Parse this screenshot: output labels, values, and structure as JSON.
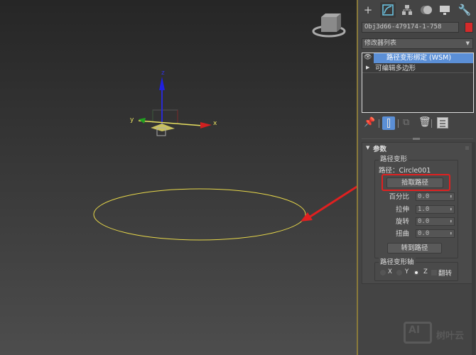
{
  "viewport": {
    "axis_x": "x",
    "axis_y": "y",
    "axis_z": "z",
    "shape_color": "#e8d84a"
  },
  "panel": {
    "tabs": [
      {
        "icon": "create-icon"
      },
      {
        "icon": "modify-icon",
        "active": true
      },
      {
        "icon": "hierarchy-icon"
      },
      {
        "icon": "motion-icon"
      },
      {
        "icon": "display-icon"
      },
      {
        "icon": "utilities-icon"
      }
    ],
    "object_name": "Obj3d66-479174-1-758",
    "object_color": "#d42a2a",
    "modifier_list": "修改器列表",
    "stack": [
      {
        "label": "路径变形绑定 (WSM)",
        "selected": true
      },
      {
        "label": "可编辑多边形",
        "selected": false
      }
    ],
    "rollout": {
      "title": "参数",
      "group1_title": "路径变形",
      "path_label": "路径：Circle001",
      "pick_path_button": "拾取路径",
      "spinners": [
        {
          "label": "百分比",
          "value": "0.0"
        },
        {
          "label": "拉伸",
          "value": "1.0"
        },
        {
          "label": "旋转",
          "value": "0.0"
        },
        {
          "label": "扭曲",
          "value": "0.0"
        }
      ],
      "move_to_path_button": "转到路径",
      "group2_title": "路径变形轴",
      "axes": [
        {
          "label": "X",
          "selected": false
        },
        {
          "label": "Y",
          "selected": false
        },
        {
          "label": "Z",
          "selected": true
        }
      ],
      "flip_label": "翻转",
      "flip_checked": false
    },
    "highlight_color": "#e02020"
  },
  "watermark": {
    "text": "树叶云",
    "logo": "AI"
  }
}
